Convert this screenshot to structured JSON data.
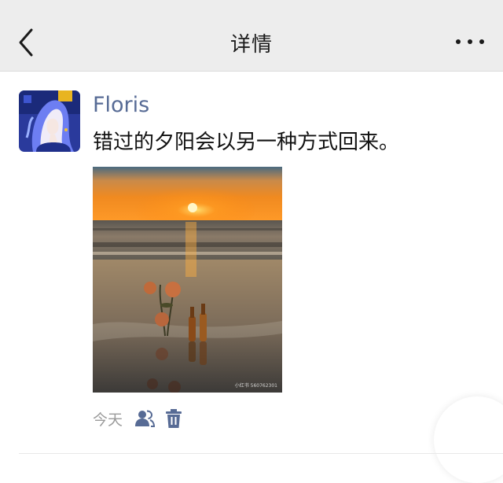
{
  "navbar": {
    "title": "详情",
    "back_icon": "chevron-left-icon",
    "more_icon": "more-horizontal-icon"
  },
  "post": {
    "avatar_icon": "avatar-illustration",
    "username": "Floris",
    "text": "错过的夕阳会以另一种方式回来。",
    "image_watermark": "小红书 560762301",
    "time": "今天",
    "like_icon": "users-icon",
    "delete_icon": "trash-icon"
  },
  "colors": {
    "nav_bg": "#ededed",
    "username": "#576b95",
    "meta_text": "#9a9a9a",
    "icon": "#576b95"
  }
}
